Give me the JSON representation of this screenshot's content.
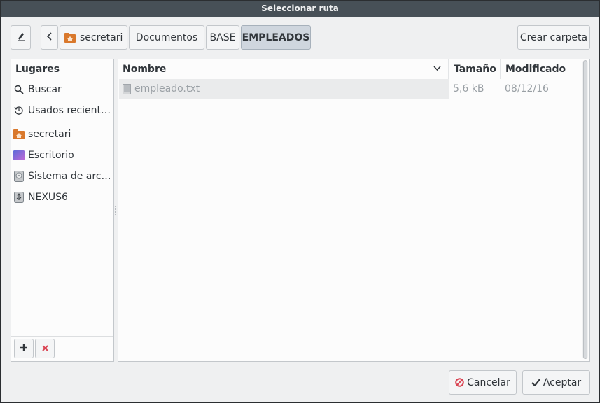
{
  "window": {
    "title": "Seleccionar ruta"
  },
  "toolbar": {
    "edit_icon": "pencil-icon",
    "back_icon": "chevron-left-icon",
    "breadcrumbs": [
      {
        "label": "secretari",
        "icon": "home-folder-icon"
      },
      {
        "label": "Documentos"
      },
      {
        "label": "BASE"
      },
      {
        "label": "EMPLEADOS",
        "active": true
      }
    ],
    "create_folder_label": "Crear carpeta"
  },
  "sidebar": {
    "title": "Lugares",
    "items": [
      {
        "label": "Buscar",
        "icon": "search-icon"
      },
      {
        "label": "Usados recient…",
        "icon": "recent-icon"
      },
      {
        "label": "secretari",
        "icon": "home-folder-icon"
      },
      {
        "label": "Escritorio",
        "icon": "desktop-icon"
      },
      {
        "label": "Sistema de arc…",
        "icon": "harddisk-icon"
      },
      {
        "label": "NEXUS6",
        "icon": "usb-drive-icon"
      }
    ],
    "add_icon": "plus-icon",
    "remove_icon": "remove-icon"
  },
  "files": {
    "columns": {
      "name": "Nombre",
      "size": "Tamaño",
      "modified": "Modificado"
    },
    "rows": [
      {
        "name": "empleado.txt",
        "size": "5,6 kB",
        "modified": "08/12/16",
        "icon": "text-file-icon"
      }
    ]
  },
  "footer": {
    "cancel_label": "Cancelar",
    "accept_label": "Aceptar"
  },
  "colors": {
    "titlebar": "#475057",
    "window_bg": "#eff0f1",
    "panel_bg": "#fcfcfc",
    "active_crumb": "#cfd6de",
    "cancel_red": "#da4453"
  }
}
